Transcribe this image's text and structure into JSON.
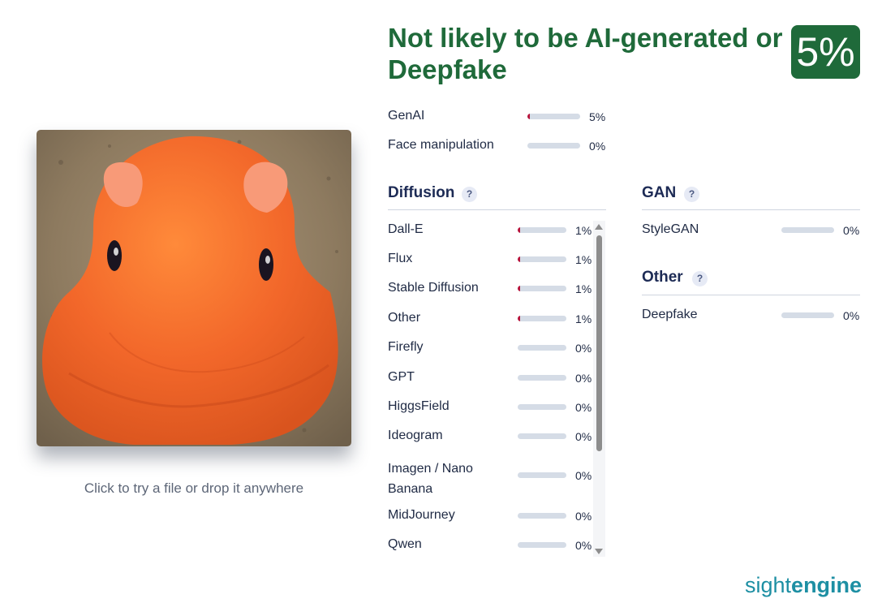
{
  "upload": {
    "hint": "Click to try a file or drop it anywhere"
  },
  "verdict": {
    "text": "Not likely to be AI-generated or Deepfake",
    "score": "5%",
    "color": "#1f6a3a"
  },
  "summary": [
    {
      "label": "GenAI",
      "pct": "5%",
      "value": 0.05
    },
    {
      "label": "Face manipulation",
      "pct": "0%",
      "value": 0
    }
  ],
  "sections": {
    "diffusion": {
      "title": "Diffusion",
      "help": "?",
      "items": [
        {
          "label": "Dall-E",
          "pct": "1%",
          "value": 0.01
        },
        {
          "label": "Flux",
          "pct": "1%",
          "value": 0.01
        },
        {
          "label": "Stable Diffusion",
          "pct": "1%",
          "value": 0.01
        },
        {
          "label": "Other",
          "pct": "1%",
          "value": 0.01
        },
        {
          "label": "Firefly",
          "pct": "0%",
          "value": 0
        },
        {
          "label": "GPT",
          "pct": "0%",
          "value": 0
        },
        {
          "label": "HiggsField",
          "pct": "0%",
          "value": 0
        },
        {
          "label": "Ideogram",
          "pct": "0%",
          "value": 0
        },
        {
          "label": "Imagen / Nano Banana",
          "pct": "0%",
          "value": 0
        },
        {
          "label": "MidJourney",
          "pct": "0%",
          "value": 0
        },
        {
          "label": "Qwen",
          "pct": "0%",
          "value": 0
        }
      ]
    },
    "gan": {
      "title": "GAN",
      "help": "?",
      "items": [
        {
          "label": "StyleGAN",
          "pct": "0%",
          "value": 0
        }
      ]
    },
    "other": {
      "title": "Other",
      "help": "?",
      "items": [
        {
          "label": "Deepfake",
          "pct": "0%",
          "value": 0
        }
      ]
    }
  },
  "brand": {
    "light": "sight",
    "bold": "engine",
    "color": "#1d8fa3"
  },
  "colors": {
    "bar_track": "#d5dce6",
    "bar_fill": "#b8123a"
  }
}
